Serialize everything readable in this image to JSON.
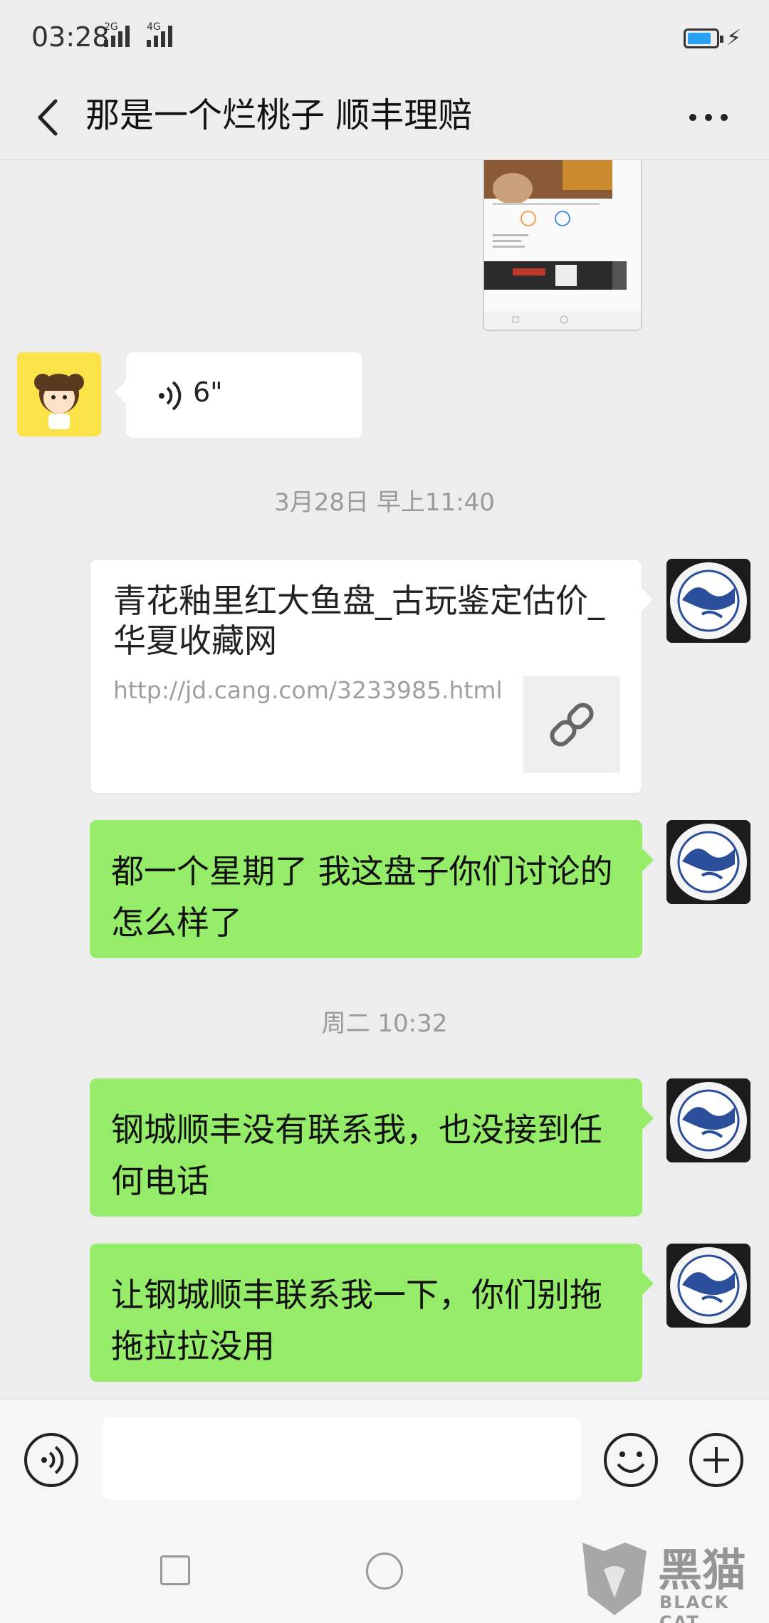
{
  "status_bar": {
    "time": "03:28",
    "signal1": "2G",
    "signal2": "4G"
  },
  "header": {
    "title": "那是一个烂桃子 顺丰理赔"
  },
  "messages": {
    "voice": {
      "duration": "6\""
    },
    "ts1": "3月28日 早上11:40",
    "link": {
      "title": "青花釉里红大鱼盘_古玩鉴定估价_华夏收藏网",
      "url": "http://jd.cang.com/3233985.html"
    },
    "m1": "都一个星期了 我这盘子你们讨论的怎么样了",
    "ts2": "周二 10:32",
    "m2": "钢城顺丰没有联系我，也没接到任何电话",
    "m3": "让钢城顺丰联系我一下，你们别拖拖拉拉没用"
  },
  "watermark": {
    "cn": "黑猫",
    "en": "BLACK CAT"
  },
  "colors": {
    "background": "#ededed",
    "sent_bubble": "#95ec69",
    "received_bubble": "#ffffff",
    "timestamp": "#9a9a9a"
  }
}
